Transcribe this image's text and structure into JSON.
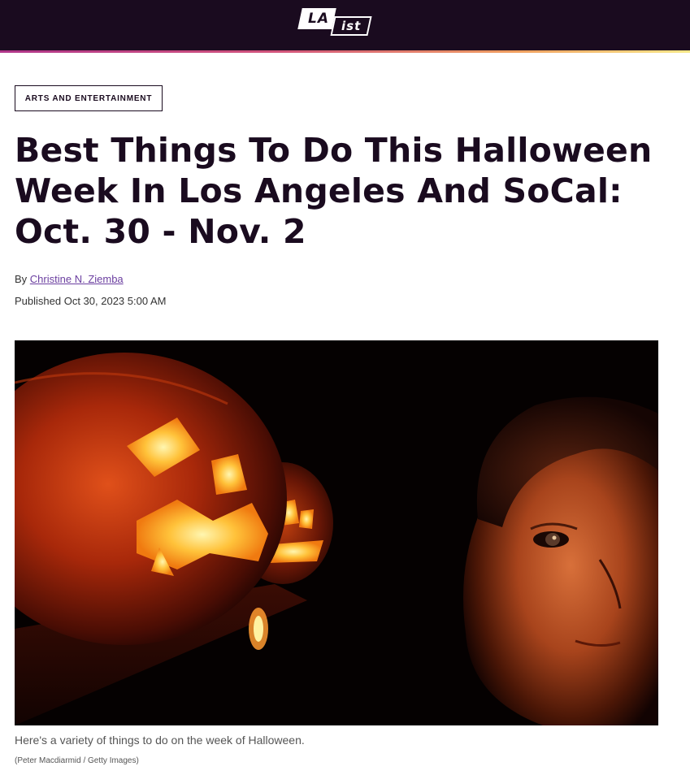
{
  "header": {
    "logo_la": "LA",
    "logo_ist": "ist"
  },
  "article": {
    "category": "ARTS AND ENTERTAINMENT",
    "headline": "Best Things To Do This Halloween Week In Los Angeles And SoCal: Oct. 30 - Nov. 2",
    "byline_prefix": "By",
    "author": "Christine N. Ziemba",
    "published": "Published Oct 30, 2023 5:00 AM",
    "image_caption": "Here's a variety of things to do on the week of Halloween.",
    "image_credit": "(Peter Macdiarmid / Getty Images)"
  },
  "colors": {
    "header_bg": "#1a0b1f",
    "author_link": "#6b3fa0"
  }
}
